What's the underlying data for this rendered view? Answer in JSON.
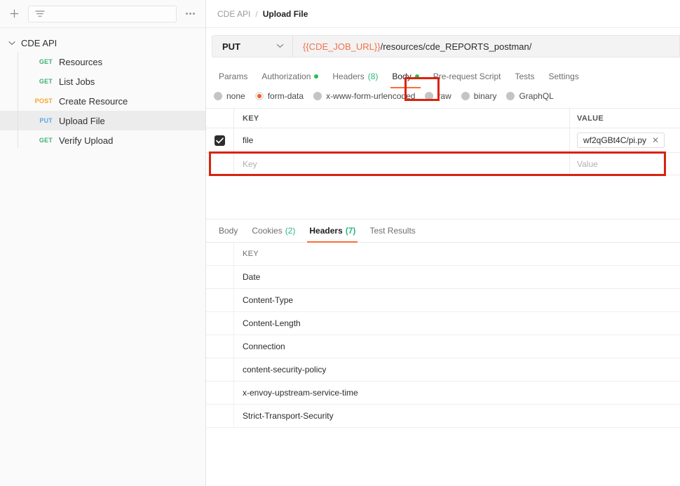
{
  "sidebar": {
    "add_label": "+",
    "filter_placeholder": "",
    "more_label": "...",
    "collection": {
      "name": "CDE API",
      "expanded": true,
      "requests": [
        {
          "method": "GET",
          "name": "Resources",
          "active": false
        },
        {
          "method": "GET",
          "name": "List Jobs",
          "active": false
        },
        {
          "method": "POST",
          "name": "Create Resource",
          "active": false
        },
        {
          "method": "PUT",
          "name": "Upload File",
          "active": true
        },
        {
          "method": "GET",
          "name": "Verify Upload",
          "active": false
        }
      ]
    }
  },
  "breadcrumb": {
    "collection": "CDE API",
    "separator": "/",
    "current": "Upload File"
  },
  "request": {
    "method": "PUT",
    "method_chevron": "⌄",
    "url_variable": "{{CDE_JOB_URL}}",
    "url_path": "/resources/cde_REPORTS_postman/",
    "tabs": [
      {
        "label": "Params",
        "badge": "",
        "dot": false,
        "active": false
      },
      {
        "label": "Authorization",
        "badge": "",
        "dot": true,
        "active": false
      },
      {
        "label": "Headers",
        "badge": "(8)",
        "dot": false,
        "active": false
      },
      {
        "label": "Body",
        "badge": "",
        "dot": true,
        "active": true
      },
      {
        "label": "Pre-request Script",
        "badge": "",
        "dot": false,
        "active": false
      },
      {
        "label": "Tests",
        "badge": "",
        "dot": false,
        "active": false
      },
      {
        "label": "Settings",
        "badge": "",
        "dot": false,
        "active": false
      }
    ],
    "body_modes": [
      {
        "label": "none",
        "selected": false
      },
      {
        "label": "form-data",
        "selected": true
      },
      {
        "label": "x-www-form-urlencoded",
        "selected": false
      },
      {
        "label": "raw",
        "selected": false
      },
      {
        "label": "binary",
        "selected": false
      },
      {
        "label": "GraphQL",
        "selected": false
      }
    ],
    "form_table": {
      "col_key": "KEY",
      "col_value": "VALUE",
      "rows": [
        {
          "checked": true,
          "key": "file",
          "value": "wf2qGBt4C/pi.py",
          "is_file": true,
          "remove_label": "✕"
        }
      ],
      "new_row": {
        "key_placeholder": "Key",
        "value_placeholder": "Value"
      }
    }
  },
  "response": {
    "tabs": [
      {
        "label": "Body",
        "badge": "",
        "active": false
      },
      {
        "label": "Cookies",
        "badge": "(2)",
        "active": false
      },
      {
        "label": "Headers",
        "badge": "(7)",
        "active": true
      },
      {
        "label": "Test Results",
        "badge": "",
        "active": false
      }
    ],
    "headers_table": {
      "col_key": "KEY",
      "rows": [
        {
          "key": "Date"
        },
        {
          "key": "Content-Type"
        },
        {
          "key": "Content-Length"
        },
        {
          "key": "Connection"
        },
        {
          "key": "content-security-policy"
        },
        {
          "key": "x-envoy-upstream-service-time"
        },
        {
          "key": "Strict-Transport-Security"
        }
      ]
    }
  },
  "annotations": {
    "body_tab_highlight": "Body",
    "file_row_highlight": "file"
  },
  "colors": {
    "accent": "#ff6c37",
    "annotation": "#d8230e",
    "green": "#28c04a",
    "get": "#3bb273",
    "post": "#f5a623",
    "put": "#5aa7e8",
    "variable": "#f2714b"
  }
}
